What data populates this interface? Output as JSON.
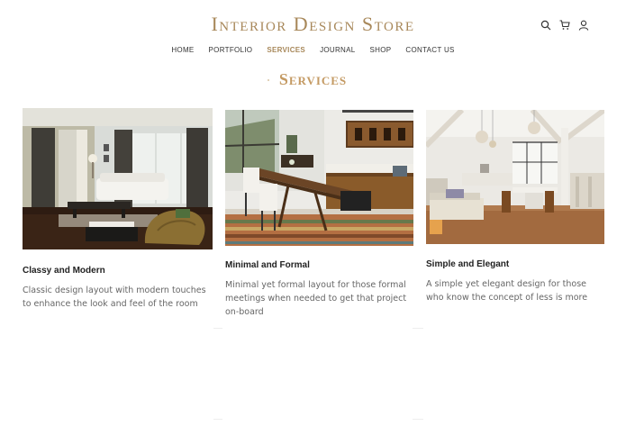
{
  "header": {
    "brand": "Interior Design Store",
    "icons": [
      "search-icon",
      "cart-icon",
      "user-icon"
    ]
  },
  "nav": {
    "items": [
      "HOME",
      "PORTFOLIO",
      "SERVICES",
      "JOURNAL",
      "SHOP",
      "CONTACT US"
    ],
    "active": "SERVICES"
  },
  "main": {
    "section_title": "Services",
    "cards": [
      {
        "title": "Classy and Modern",
        "text": "Classic design layout with modern touches to enhance the look and feel of the room"
      },
      {
        "title": "Minimal and Formal",
        "text": "Minimal yet formal layout for those formal meetings when needed to get that project on-board"
      },
      {
        "title": "Simple and Elegant",
        "text": "A simple yet elegant design for those who know the concept of less is more"
      }
    ]
  },
  "colors": {
    "accent": "#a8885a",
    "title": "#c49a63",
    "text": "#666666"
  }
}
